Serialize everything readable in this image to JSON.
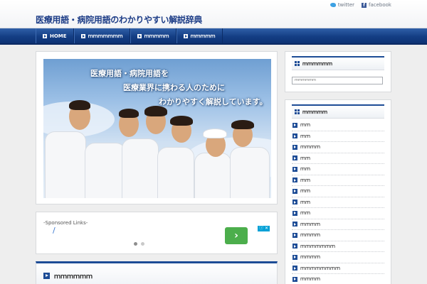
{
  "header": {
    "site_title": "医療用語・病院用語のわかりやすい解説辞典",
    "social": [
      {
        "label": "twitter",
        "icon": "twitter-icon"
      },
      {
        "label": "facebook",
        "icon": "facebook-icon"
      }
    ]
  },
  "nav": {
    "items": [
      {
        "label": "HOME"
      },
      {
        "label": "ｍｍｍｍｍｍｍ"
      },
      {
        "label": "ｍｍｍｍｍ"
      },
      {
        "label": "ｍｍｍｍｍ"
      }
    ]
  },
  "hero": {
    "lines": [
      "医療用語・病院用語を",
      "医療業界に携わる人のために",
      "わかりやすく解説しています。"
    ]
  },
  "ad": {
    "label": "-Sponsored Links-",
    "link_text": "/",
    "button_glyph": "›",
    "badge": "ⓘ ✕",
    "dots": 2,
    "active_dot": 0
  },
  "section": {
    "title": "ｍｍｍｍｍｍ"
  },
  "sidebar": {
    "search": {
      "title": "ｍｍｍｍｍｍ",
      "placeholder": "ｍｍｍｍｍｍ"
    },
    "categories": {
      "title": "ｍｍｍｍｍ",
      "items": [
        {
          "label": "ｍｍ"
        },
        {
          "label": "ｍｍ"
        },
        {
          "label": "ｍｍｍｍ"
        },
        {
          "label": "ｍｍ"
        },
        {
          "label": "ｍｍ"
        },
        {
          "label": "ｍｍ"
        },
        {
          "label": "ｍｍ"
        },
        {
          "label": "ｍｍ"
        },
        {
          "label": "ｍｍ"
        },
        {
          "label": "ｍｍｍｍ"
        },
        {
          "label": "ｍｍｍｍ"
        },
        {
          "label": "ｍｍｍｍｍｍｍ"
        },
        {
          "label": "ｍｍｍｍ"
        },
        {
          "label": "ｍｍｍｍｍｍｍｍ"
        },
        {
          "label": "ｍｍｍｍ"
        }
      ]
    }
  },
  "colors": {
    "brand_blue": "#1d4c96",
    "nav_blue": "#143e84",
    "ad_button": "#4cae4c"
  }
}
